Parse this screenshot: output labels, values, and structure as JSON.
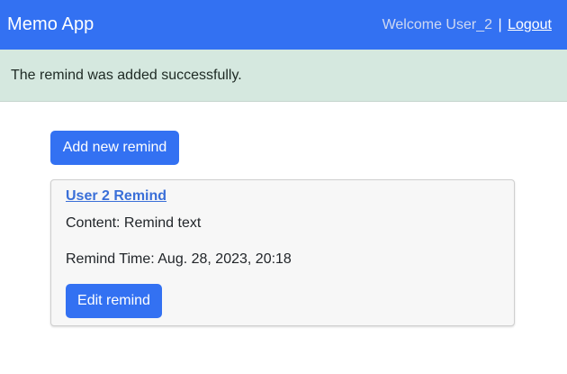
{
  "navbar": {
    "brand": "Memo App",
    "welcome": "Welcome User_2",
    "separator": "|",
    "logout_label": "Logout",
    "bg_color": "#3371f2"
  },
  "alert": {
    "message": "The remind was added successfully.",
    "bg_color": "#d5e8df"
  },
  "main": {
    "add_button_label": "Add new remind",
    "reminds": [
      {
        "title": "User 2 Remind",
        "content": "Content: Remind text",
        "remind_time": "Remind Time: Aug. 28, 2023, 20:18",
        "edit_label": "Edit remind"
      }
    ]
  }
}
